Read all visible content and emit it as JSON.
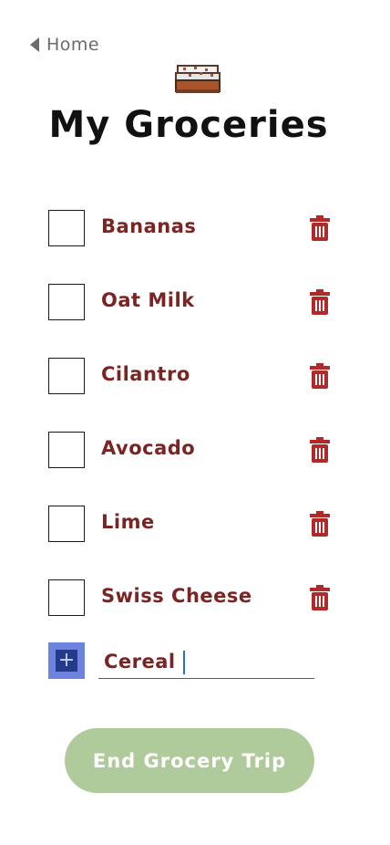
{
  "nav": {
    "back_label": "Home"
  },
  "header": {
    "title": "My Groceries",
    "icon": "cake-icon"
  },
  "items": [
    {
      "label": "Bananas",
      "checked": false
    },
    {
      "label": "Oat Milk",
      "checked": false
    },
    {
      "label": "Cilantro",
      "checked": false
    },
    {
      "label": "Avocado",
      "checked": false
    },
    {
      "label": "Lime",
      "checked": false
    },
    {
      "label": "Swiss Cheese",
      "checked": false
    }
  ],
  "add_item": {
    "value": "Cereal",
    "button_symbol": "+"
  },
  "footer": {
    "end_button_label": "End Grocery Trip"
  },
  "colors": {
    "item_text": "#7a2424",
    "trash": "#b02a2a",
    "add_button": "#6d83e0",
    "end_button": "#b0cb9b"
  }
}
